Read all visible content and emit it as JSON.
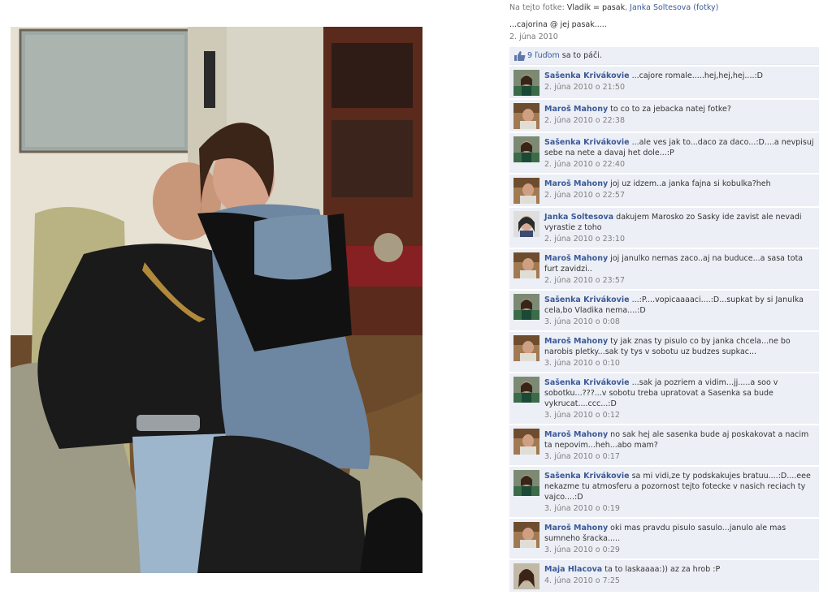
{
  "tags": {
    "prefix": "Na tejto fotke: ",
    "person1": "Vladik = pasak",
    "sep": ", ",
    "person2": "Janka Soltesova",
    "album": "(fotky)"
  },
  "caption": {
    "text": "...cajorina @ jej pasak.....",
    "date": "2. júna 2010"
  },
  "likes": {
    "count_label": "9 ľuďom",
    "suffix": " sa to páči."
  },
  "comments": [
    {
      "name": "Sašenka Krivákovie",
      "text": " ...cajore romale.....hej,hej,hej....:D",
      "date": "2. júna 2010 o 21:50",
      "avatar": "sasenka-avatar"
    },
    {
      "name": "Maroš Mahony",
      "text": " to co to za jebacka natej fotke?",
      "date": "2. júna 2010 o 22:38",
      "avatar": "maros-avatar"
    },
    {
      "name": "Sašenka Krivákovie",
      "text": " ...ale ves jak to...daco za daco...:D....a nevpisuj sebe na nete a davaj het dole...:P",
      "date": "2. júna 2010 o 22:40",
      "avatar": "sasenka-avatar"
    },
    {
      "name": "Maroš Mahony",
      "text": " joj uz idzem..a janka fajna si kobulka?heh",
      "date": "2. júna 2010 o 22:57",
      "avatar": "maros-avatar"
    },
    {
      "name": "Janka Soltesova",
      "text": " dakujem Marosko zo Sasky ide zavist ale nevadi vyrastie z toho",
      "date": "2. júna 2010 o 23:10",
      "avatar": "janka-avatar"
    },
    {
      "name": "Maroš Mahony",
      "text": " joj janulko nemas zaco..aj na buduce...a sasa tota furt zavidzi..",
      "date": "2. júna 2010 o 23:57",
      "avatar": "maros-avatar"
    },
    {
      "name": "Sašenka Krivákovie",
      "text": " ...:P....vopicaaaaci....:D...supkat by si Janulka cela,bo Vladika nema....:D",
      "date": "3. júna 2010 o 0:08",
      "avatar": "sasenka-avatar"
    },
    {
      "name": "Maroš Mahony",
      "text": " ty jak znas ty pisulo co by janka chcela...ne bo narobis pletky...sak ty tys v sobotu uz budzes supkac...",
      "date": "3. júna 2010 o 0:10",
      "avatar": "maros-avatar"
    },
    {
      "name": "Sašenka Krivákovie",
      "text": " ...sak ja pozriem a vidim...jj.....a soo v sobotku...???...v sobotu treba upratovat a Sasenka sa bude vykrucat....ccc...:D",
      "date": "3. júna 2010 o 0:12",
      "avatar": "sasenka-avatar"
    },
    {
      "name": "Maroš Mahony",
      "text": " no sak hej ale sasenka bude aj poskakovat a nacim ta nepovim...heh...abo mam?",
      "date": "3. júna 2010 o 0:17",
      "avatar": "maros-avatar"
    },
    {
      "name": "Sašenka Krivákovie",
      "text": " sa mi vidi,ze ty podskakujes bratuu....:D....eee nekazme tu atmosferu a pozornost tejto fotecke v nasich reciach ty vajco....:D",
      "date": "3. júna 2010 o 0:19",
      "avatar": "sasenka-avatar"
    },
    {
      "name": "Maroš Mahony",
      "text": " oki mas pravdu pisulo sasulo...janulo ale mas sumneho šracka.....",
      "date": "3. júna 2010 o 0:29",
      "avatar": "maros-avatar"
    },
    {
      "name": "Maja Hlacova",
      "text": " ta to laskaaaa:)) az za hrob :P",
      "date": "4. júna 2010 o 7:25",
      "avatar": "maja-avatar"
    }
  ],
  "colors": {
    "link": "#3b5998",
    "comment_bg": "#eceff5",
    "muted": "#808080"
  }
}
